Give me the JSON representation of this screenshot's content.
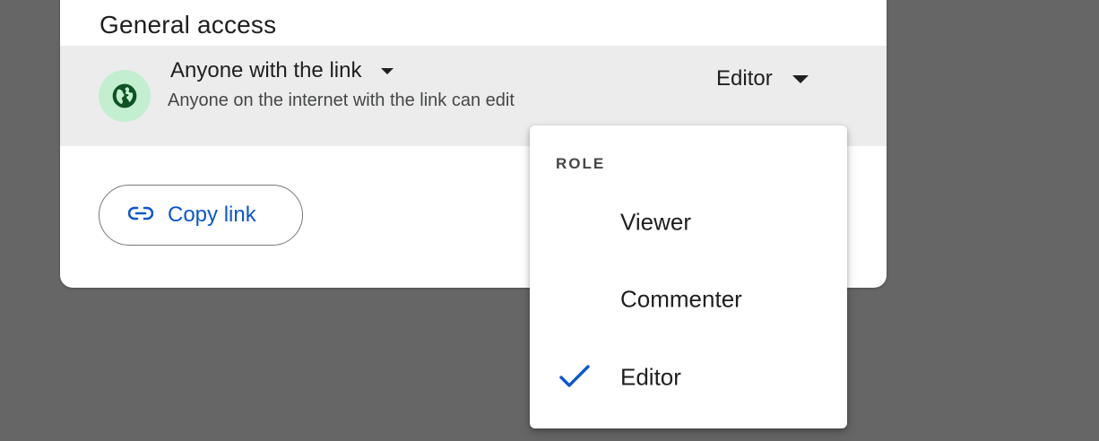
{
  "general_access": {
    "title": "General access",
    "scope_label": "Anyone with the link",
    "scope_description": "Anyone on the internet with the link can edit",
    "role_label": "Editor",
    "scope_icon": "globe-icon"
  },
  "copy_link": {
    "label": "Copy link",
    "icon": "link-icon"
  },
  "role_menu": {
    "header": "ROLE",
    "items": [
      {
        "label": "Viewer",
        "selected": false
      },
      {
        "label": "Commenter",
        "selected": false
      },
      {
        "label": "Editor",
        "selected": true
      }
    ]
  },
  "colors": {
    "accent": "#0b57d0",
    "globe_bg": "#c4eed0",
    "globe_fg": "#0f5223",
    "row_bg": "#ececec",
    "backdrop": "#666666"
  }
}
